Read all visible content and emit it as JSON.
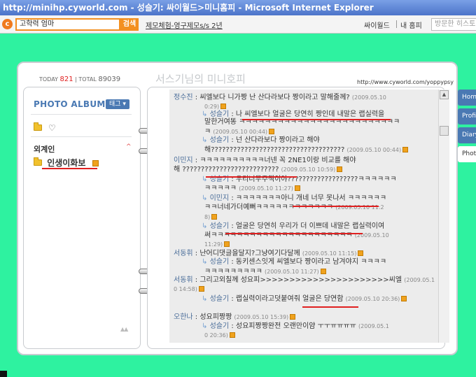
{
  "window": {
    "title": "http://minihp.cyworld.com - 성슬기: 싸이월드>미니홈피 - Microsoft Internet Explorer"
  },
  "toolbar": {
    "search_value": "고학력 엄마",
    "search_button": "검색",
    "link": "제모체험-영구제모s/s 2년",
    "cyworld": "싸이월드",
    "my_home": "내 홈피",
    "visited_placeholder": "방문한 히스토리"
  },
  "header": {
    "today_label": "TODAY",
    "today_count": "821",
    "total_label": "TOTAL",
    "total_count": "89039",
    "page_title": "서스기님의 미니호피",
    "url": "http://www.cyworld.com/yoppypsy"
  },
  "left": {
    "album_title": "PHOTO ALBUM",
    "tag_button": "태그 ▾",
    "heart": "♡",
    "category_title": "외계인",
    "category_caret": "^",
    "category_item": "인생이화보",
    "arrows": "▲▲"
  },
  "comments": [
    {
      "author": "정수진",
      "text": " : 씨엘보다 니가짱 난 산다라보다 짱이라고 말해줄께? ",
      "time": "(2009.05.10",
      "badge": false
    },
    {
      "indent": true,
      "text": "0:29)",
      "time": "",
      "badge": true,
      "plain_time": true
    },
    {
      "reply": true,
      "author": "성슬기",
      "text": " : 나 씨엘보다 얼굴은 당연히 짱인데 내말은 랩실력을",
      "badge": false
    },
    {
      "indent": true,
      "text": "말한거여똥 ㅋㅋㅋㅋㅋㅋㅋㅋㅋㅋㅋㅋㅋㅋㅋㅋㅋㅋㅋㅋㅋㅋㅋㅋㅋ",
      "badge": false
    },
    {
      "indent": true,
      "text": "ㅋ ",
      "time": "(2009.05.10 00:44)",
      "badge": true
    },
    {
      "reply": true,
      "author": "성슬기",
      "text": " : 넌 산다라보다 짱이라고 해야",
      "badge": false
    },
    {
      "indent": true,
      "text": "해???????????????????????????????????? ",
      "time": "(2009.05.10 00:44)",
      "badge": true
    },
    {
      "author": "이민지",
      "text": " : ㅋㅋㅋㅋㅋㅋㅋㅋㅋㅋ너넨 꼭 2NE1이랑 비교를 해야",
      "badge": false
    },
    {
      "text": "해 ?????????????????????????? ",
      "time": "(2009.05.10 10:59)",
      "badge": true
    },
    {
      "reply": true,
      "author": "성슬기",
      "text": " : 우리너무주책이야???????????????????ㅋㅋㅋㅋㅋㅋ",
      "badge": false
    },
    {
      "indent": true,
      "text": "ㅋㅋㅋㅋㅋ ",
      "time": "(2009.05.10 11:27)",
      "badge": true
    },
    {
      "reply": true,
      "author": "이민지",
      "text": " : ㅋㅋㅋㅋㅋㅋㅋ아니 개네 너무 못나서 ㅋㅋㅋㅋㅋㅋ",
      "badge": false
    },
    {
      "indent": true,
      "text": "ㅋㅋ너네가더예뻐ㅋㅋㅋㅋㅋㅋㅋㅋㅋㅋㅋㅋ ",
      "time": "(2009.05.10 11:2",
      "badge": false
    },
    {
      "indent": true,
      "text": "8)",
      "badge": true,
      "plain_time": true
    },
    {
      "reply": true,
      "author": "성슬기",
      "text": " : 얼굴은 당연히 우리가 더 이쁘데 내말은 랩실력이여",
      "badge": false
    },
    {
      "indent": true,
      "text": "써ㅋㅋㅋㅋㅋㅋㅋㅋㅋㅋㅋㅋㅋㅋㅋㅋㅋㅋㅋㅋㅋㅋ ",
      "time": "(2009.05.10",
      "badge": false
    },
    {
      "indent": true,
      "text": "11:29)",
      "badge": true,
      "plain_time": true
    },
    {
      "author": "서동휘",
      "text": " : 난어디댓글을달지?그냥여기다달께 ",
      "time": "(2009.05.10 11:15)",
      "badge": true
    },
    {
      "reply": true,
      "author": "성슬기",
      "text": " : 동키센스잇게 씨엘보다 짱이라고 남겨야지 ㅋㅋㅋㅋ",
      "badge": false
    },
    {
      "indent": true,
      "text": "ㅋㅋㅋㅋㅋㅋㅋㅋㅋ ",
      "time": "(2009.05.10 11:27)",
      "badge": true
    },
    {
      "author": "서동휘",
      "text": " : 그리고외칠께 성요피>>>>>>>>>>>>>>>>>>>>>>씨엘 ",
      "time": "(2009.05.1",
      "badge": false
    },
    {
      "text": "0 14:58)",
      "badge": true,
      "plain_time": true
    },
    {
      "reply": true,
      "author": "성슬기",
      "text": " : 랩실력이라고덧붙여줘 얼굴은 당연함 ",
      "time": "(2009.05.10 20:36)",
      "badge": true
    },
    {
      "author": "오한나",
      "text": " : 성요피짱짱 ",
      "time": "(2009.05.10 15:39)",
      "badge": true
    },
    {
      "reply": true,
      "author": "성슬기",
      "text": " : 성요피짱짱완전 오랜만이얌 ㅜㅜㅠㅠㅠㅠ ",
      "time": "(2009.05.1",
      "badge": false
    },
    {
      "indent": true,
      "text": "0 20:36)",
      "badge": true,
      "plain_time": true
    }
  ],
  "tabs": [
    "Home",
    "Profile",
    "Diary",
    "Photo"
  ],
  "colors": {
    "background": "#2ef2a0",
    "accent": "#4a79b3",
    "underline": "#e02020",
    "search_border": "#f39021"
  }
}
